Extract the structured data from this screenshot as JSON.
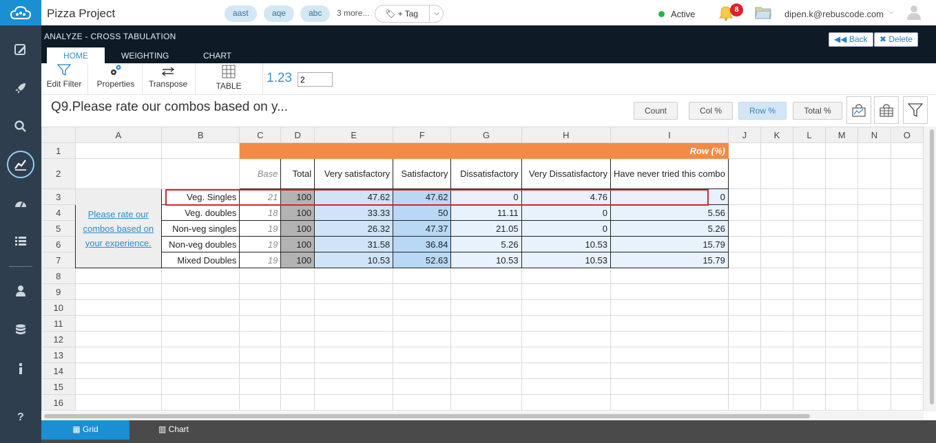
{
  "app": {
    "title": "Pizza Project"
  },
  "tags": [
    "aast",
    "aqe",
    "abc"
  ],
  "more_tags": "3 more...",
  "add_tag": "+ Tag",
  "status": {
    "label": "Active",
    "color": "#2bb24c"
  },
  "notifications": {
    "count": "8"
  },
  "user": {
    "email": "dipen.k@rebuscode.com"
  },
  "section_title": "ANALYZE - CROSS TABULATION",
  "tabs": [
    "HOME",
    "WEIGHTING",
    "CHART"
  ],
  "header_buttons": {
    "back": "Back",
    "delete": "Delete"
  },
  "toolbar": {
    "edit_filter": "Edit Filter",
    "properties": "Properties",
    "transpose": "Transpose",
    "table": "TABLE",
    "decimals_label": "1.23",
    "decimals_value": "2"
  },
  "question_title": "Q9.Please rate our combos based on y...",
  "pct_buttons": [
    "Count",
    "Col %",
    "Row %",
    "Total %"
  ],
  "active_pct": "Row %",
  "grid": {
    "columns": [
      "A",
      "B",
      "C",
      "D",
      "E",
      "F",
      "G",
      "H",
      "I",
      "J",
      "K",
      "L",
      "M",
      "N",
      "O"
    ],
    "rows": [
      "1",
      "2",
      "3",
      "4",
      "5",
      "6",
      "7",
      "8",
      "9",
      "10",
      "11",
      "12",
      "13",
      "14",
      "15",
      "16"
    ],
    "banner": "Row (%)",
    "header_base": "Base",
    "header_total": "Total",
    "headers": [
      "Very satisfactory",
      "Satisfactory",
      "Dissatisfactory",
      "Very Dissatisfactory",
      "Have never tried this combo"
    ],
    "question_label": "Please rate our combos based on your experience.",
    "data_rows": [
      {
        "label": "Veg. Singles",
        "base": "21",
        "total": "100",
        "values": [
          "47.62",
          "47.62",
          "0",
          "4.76",
          "0"
        ]
      },
      {
        "label": "Veg. doubles",
        "base": "18",
        "total": "100",
        "values": [
          "33.33",
          "50",
          "11.11",
          "0",
          "5.56"
        ]
      },
      {
        "label": "Non-veg singles",
        "base": "19",
        "total": "100",
        "values": [
          "26.32",
          "47.37",
          "21.05",
          "0",
          "5.26"
        ]
      },
      {
        "label": "Non-veg doubles",
        "base": "19",
        "total": "100",
        "values": [
          "31.58",
          "36.84",
          "5.26",
          "10.53",
          "15.79"
        ]
      },
      {
        "label": "Mixed Doubles",
        "base": "19",
        "total": "100",
        "values": [
          "10.53",
          "52.63",
          "10.53",
          "10.53",
          "15.79"
        ]
      }
    ]
  },
  "bottom_tabs": [
    "Grid",
    "Chart"
  ],
  "colors": {
    "accent": "#1a8fd3",
    "banner": "#f58a45",
    "highlight": "#d4232a",
    "total": "#b3b3b3"
  }
}
